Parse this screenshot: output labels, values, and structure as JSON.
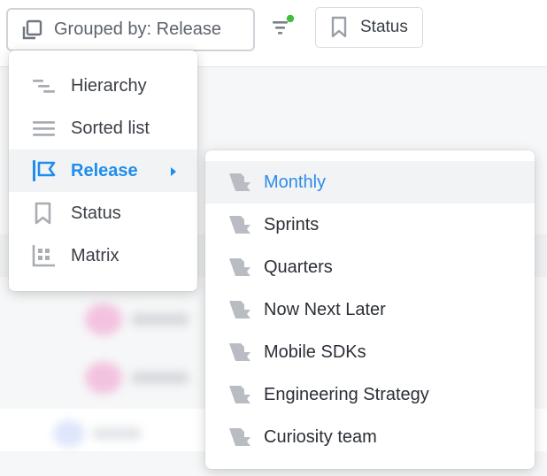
{
  "toolbar": {
    "group_by_label": "Grouped by: Release",
    "status_label": "Status"
  },
  "group_menu": {
    "items": [
      {
        "label": "Hierarchy",
        "icon": "hierarchy-icon"
      },
      {
        "label": "Sorted list",
        "icon": "list-icon"
      },
      {
        "label": "Release",
        "icon": "release-flag-icon",
        "active": true,
        "has_submenu": true
      },
      {
        "label": "Status",
        "icon": "bookmark-icon"
      },
      {
        "label": "Matrix",
        "icon": "matrix-icon"
      }
    ]
  },
  "release_menu": {
    "items": [
      {
        "label": "Monthly",
        "active": true
      },
      {
        "label": "Sprints"
      },
      {
        "label": "Quarters"
      },
      {
        "label": "Now Next Later"
      },
      {
        "label": "Mobile SDKs"
      },
      {
        "label": "Engineering Strategy"
      },
      {
        "label": "Curiosity team"
      }
    ]
  },
  "colors": {
    "accent": "#1f8ded",
    "filter_dot": "#3fbf3f",
    "icon_gray": "#a9adb3"
  }
}
